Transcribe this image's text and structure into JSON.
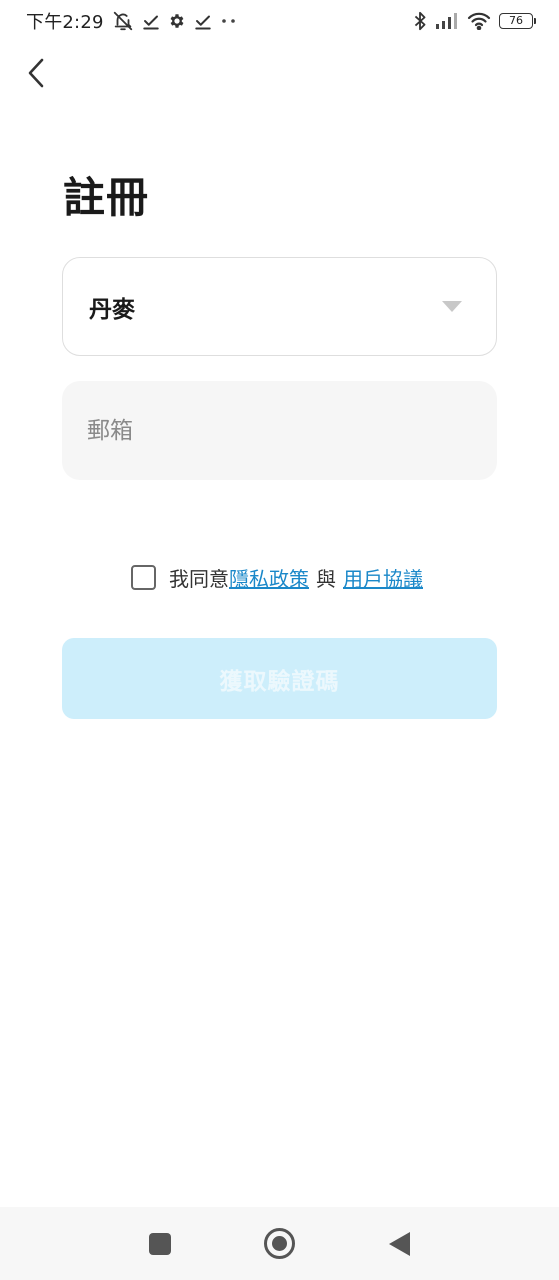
{
  "status_bar": {
    "time": "下午2:29",
    "battery_level": "76",
    "icons": [
      "bell-mute-icon",
      "check-download-icon",
      "gear-icon",
      "check-download-icon",
      "more-dots-icon",
      "bluetooth-icon",
      "signal-icon",
      "wifi-icon",
      "battery-icon"
    ]
  },
  "header": {
    "back_icon": "chevron-left-icon"
  },
  "page": {
    "title": "註冊"
  },
  "form": {
    "country_value": "丹麥",
    "country_dropdown_icon": "caret-down-icon",
    "email_placeholder": "郵箱",
    "email_value": ""
  },
  "agreement": {
    "prefix": "我同意",
    "privacy_link": "隱私政策",
    "conjunction": "與",
    "terms_link": "用戶協議",
    "checked": false
  },
  "submit": {
    "label": "獲取驗證碼",
    "enabled": false
  },
  "nav_bar": {
    "icons": [
      "recents-square-icon",
      "home-circle-icon",
      "back-triangle-icon"
    ]
  },
  "colors": {
    "link": "#1b88c9",
    "button_disabled_bg": "#cdeefb",
    "input_bg": "#f6f6f6"
  }
}
